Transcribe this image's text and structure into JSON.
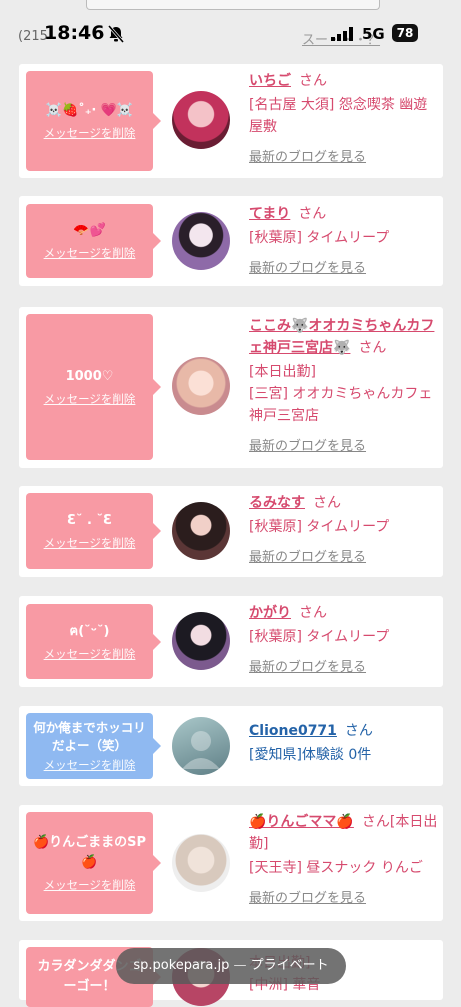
{
  "status": {
    "time": "18:46",
    "network": "5G",
    "battery": "78",
    "top_note": "(215",
    "right_note": "スー・・・？"
  },
  "cards": [
    {
      "message": "☠️🍓˚₊‧ 💗☠️",
      "delete": "メッセージを削除",
      "name": "いちご",
      "san": "さん",
      "shop": "[名古屋 大須] 怨念喫茶 幽遊屋敷",
      "blog": "最新のブログを見る"
    },
    {
      "message": "🪭💕",
      "delete": "メッセージを削除",
      "name": "てまり",
      "san": "さん",
      "shop": "[秋葉原] タイムリープ",
      "blog": "最新のブログを見る"
    },
    {
      "message": "1000♡",
      "delete": "メッセージを削除",
      "name": "ここみ🐺オオカミちゃんカフェ神戸三宮店🐺",
      "san": "さん",
      "shop": "[本日出勤]\n[三宮] オオカミちゃんカフェ神戸三宮店",
      "blog": "最新のブログを見る"
    },
    {
      "message": "Ɛ˘ . ˘Ɛ",
      "delete": "メッセージを削除",
      "name": "るみなす",
      "san": "さん",
      "shop": "[秋葉原] タイムリープ",
      "blog": "最新のブログを見る"
    },
    {
      "message": "ฅ(˘ᵕ˘)",
      "delete": "メッセージを削除",
      "name": "かがり",
      "san": "さん",
      "shop": "[秋葉原] タイムリープ",
      "blog": "最新のブログを見る"
    },
    {
      "message": "何か俺までホッコリだよー（笑）",
      "delete": "メッセージを削除",
      "name": "Clione0771",
      "san": "さん",
      "shop": "[愛知県]体験談 0件",
      "blog": ""
    },
    {
      "message": "🍎りんごままのSP🍎",
      "delete": "メッセージを削除",
      "name": "🍎りんごママ🍎",
      "san": "さん[本日出勤]",
      "shop": "[天王寺] 昼スナック りんご",
      "blog": "最新のブログを見る"
    },
    {
      "message": "カラダンダダンゴーゴー！",
      "delete": "",
      "name": "",
      "san": "",
      "shop": "本日出勤]\n[中洲] 華音",
      "blog": ""
    }
  ],
  "url_bar": {
    "domain": "sp.pokepara.jp",
    "separator": "—",
    "mode": "プライベート"
  },
  "colors": {
    "pink": "#f89aa4",
    "blue": "#8fb9f1",
    "name_pink": "#d64a6e",
    "name_blue": "#2463a8"
  }
}
